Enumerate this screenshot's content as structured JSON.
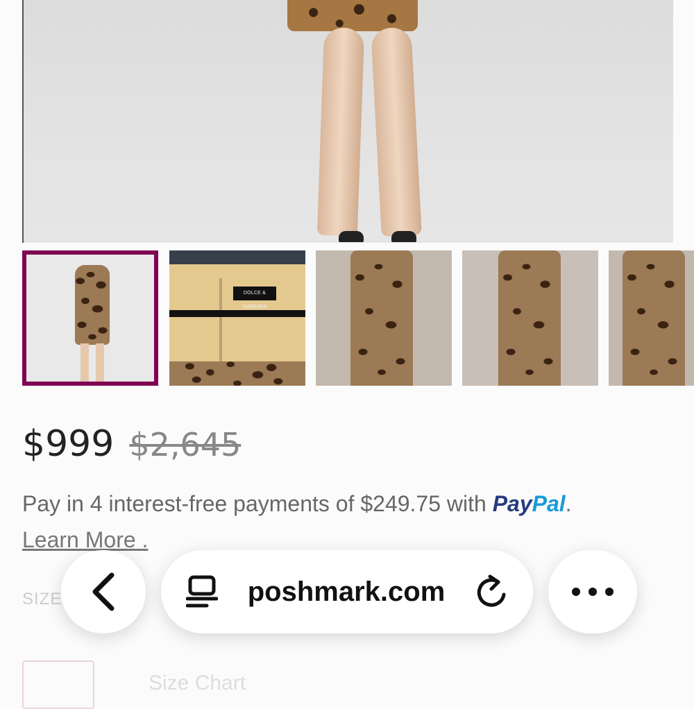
{
  "product": {
    "price": "$999",
    "original_price": "$2,645",
    "thumbnail_tag": "DOLCE & GABBANA",
    "selected_thumbnail": 1
  },
  "paypal": {
    "text": "Pay in 4 interest-free payments of $249.75 with ",
    "logo_pay": "Pay",
    "logo_pal": "Pal",
    "after": ".",
    "learn_more": "Learn More",
    "learn_more_after": " ."
  },
  "size": {
    "label": "SIZE",
    "chart_link": "Size Chart"
  },
  "browser": {
    "url": "poshmark.com"
  },
  "colors": {
    "selected_border": "#7f0353",
    "paypal_pay": "#253b80",
    "paypal_pal": "#179bd7"
  }
}
